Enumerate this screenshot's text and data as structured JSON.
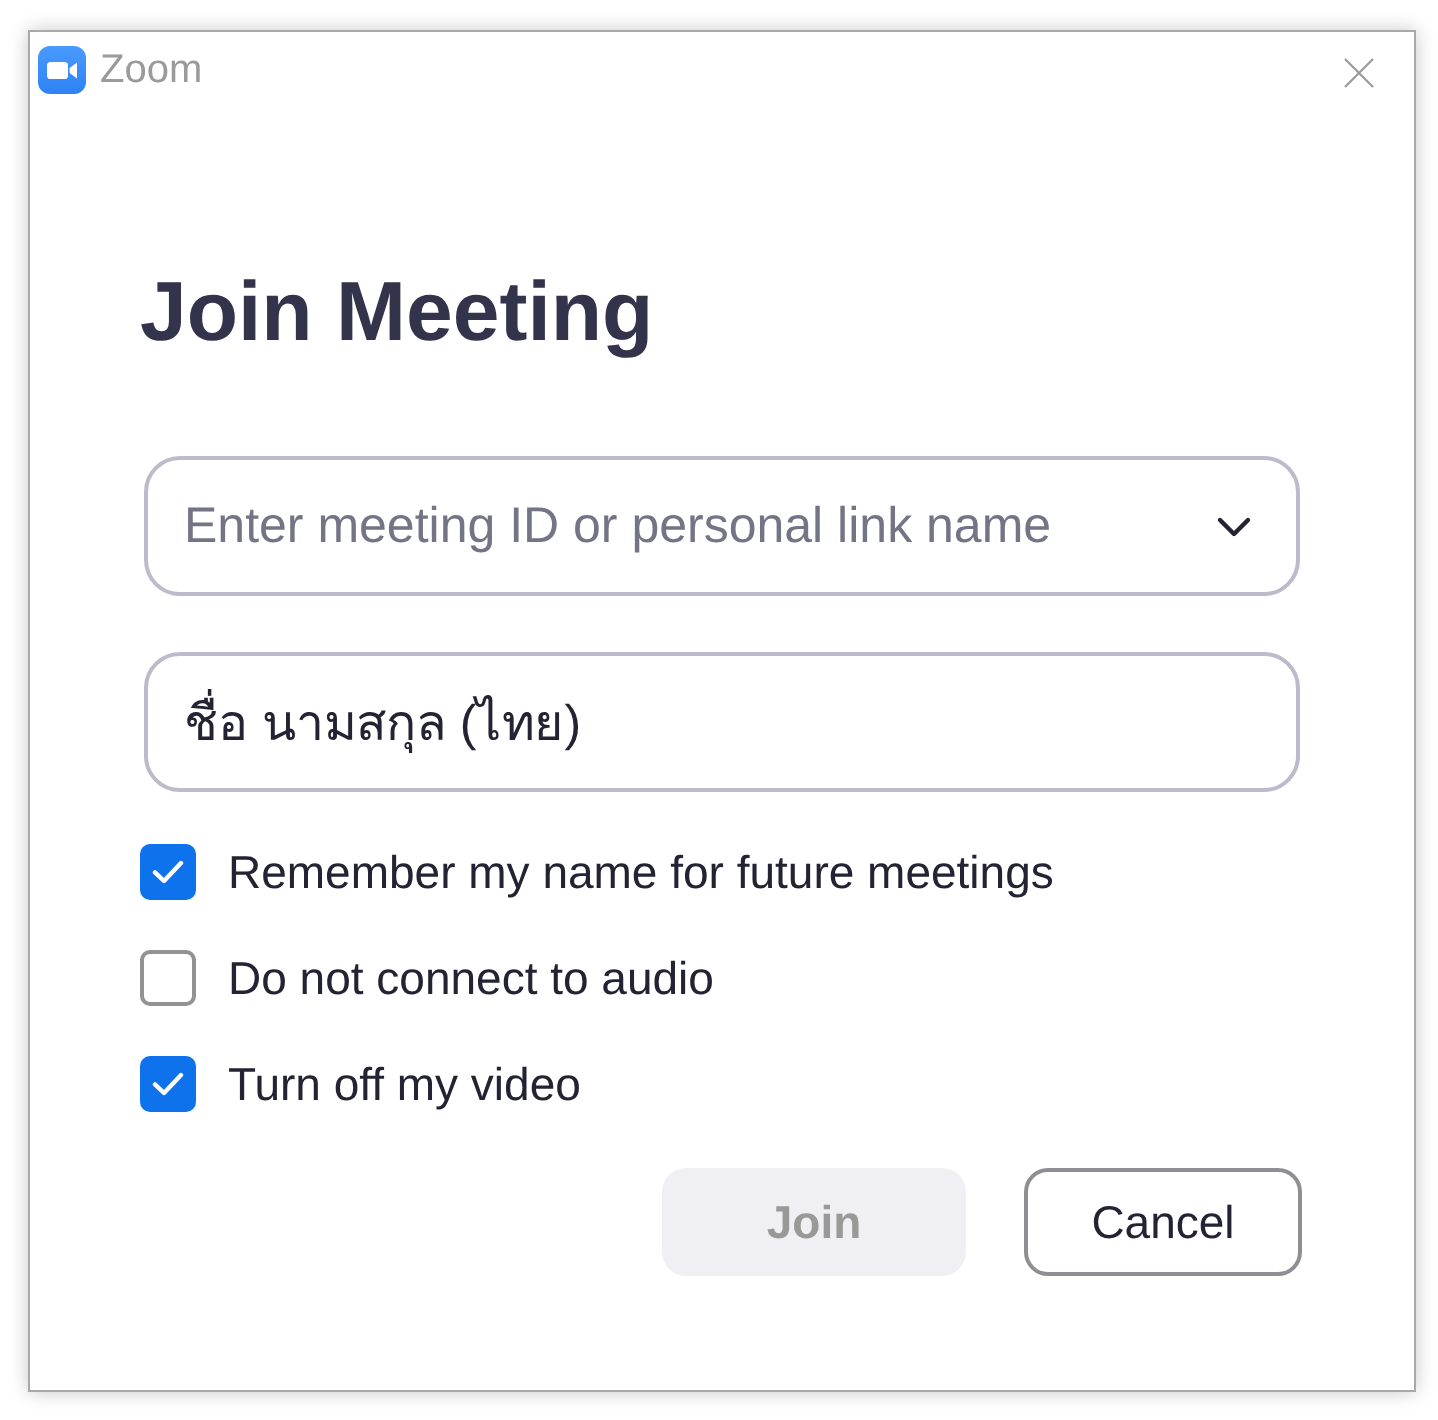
{
  "window": {
    "title": "Zoom"
  },
  "heading": "Join Meeting",
  "fields": [
    {
      "kind": "dropdown",
      "placeholder": "Enter meeting ID or personal link name"
    },
    {
      "kind": "text",
      "value": "ชื่อ นามสกุล (ไทย)"
    }
  ],
  "options": [
    {
      "label": "Remember my name for future meetings",
      "checked": true
    },
    {
      "label": "Do not connect to audio",
      "checked": false
    },
    {
      "label": "Turn off my video",
      "checked": true
    }
  ],
  "buttons": [
    {
      "label": "Join",
      "kind": "primary",
      "disabled": true
    },
    {
      "label": "Cancel",
      "kind": "secondary",
      "disabled": false
    }
  ]
}
